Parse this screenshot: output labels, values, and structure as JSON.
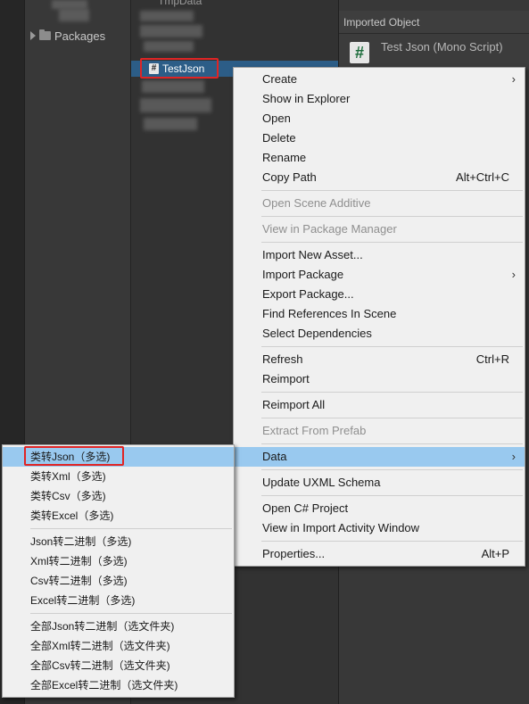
{
  "project": {
    "folder_label": "Packages",
    "top_asset_label": "TmpData"
  },
  "selected_asset": {
    "label": "TestJson"
  },
  "inspector": {
    "header": "Imported Object",
    "object_title": "Test Json (Mono Script)",
    "icon": "#"
  },
  "context_menu": {
    "items": [
      {
        "label": "Create",
        "shortcut": "",
        "submenu": true,
        "disabled": false
      },
      {
        "label": "Show in Explorer",
        "shortcut": "",
        "submenu": false,
        "disabled": false
      },
      {
        "label": "Open",
        "shortcut": "",
        "submenu": false,
        "disabled": false
      },
      {
        "label": "Delete",
        "shortcut": "",
        "submenu": false,
        "disabled": false
      },
      {
        "label": "Rename",
        "shortcut": "",
        "submenu": false,
        "disabled": false
      },
      {
        "label": "Copy Path",
        "shortcut": "Alt+Ctrl+C",
        "submenu": false,
        "disabled": false
      },
      {
        "label": "Open Scene Additive",
        "shortcut": "",
        "submenu": false,
        "disabled": true
      },
      {
        "label": "View in Package Manager",
        "shortcut": "",
        "submenu": false,
        "disabled": true
      },
      {
        "label": "Import New Asset...",
        "shortcut": "",
        "submenu": false,
        "disabled": false
      },
      {
        "label": "Import Package",
        "shortcut": "",
        "submenu": true,
        "disabled": false
      },
      {
        "label": "Export Package...",
        "shortcut": "",
        "submenu": false,
        "disabled": false
      },
      {
        "label": "Find References In Scene",
        "shortcut": "",
        "submenu": false,
        "disabled": false
      },
      {
        "label": "Select Dependencies",
        "shortcut": "",
        "submenu": false,
        "disabled": false
      },
      {
        "label": "Refresh",
        "shortcut": "Ctrl+R",
        "submenu": false,
        "disabled": false
      },
      {
        "label": "Reimport",
        "shortcut": "",
        "submenu": false,
        "disabled": false
      },
      {
        "label": "Reimport All",
        "shortcut": "",
        "submenu": false,
        "disabled": false
      },
      {
        "label": "Extract From Prefab",
        "shortcut": "",
        "submenu": false,
        "disabled": true
      },
      {
        "label": "Data",
        "shortcut": "",
        "submenu": true,
        "disabled": false,
        "highlighted": true
      },
      {
        "label": "Update UXML Schema",
        "shortcut": "",
        "submenu": false,
        "disabled": false
      },
      {
        "label": "Open C# Project",
        "shortcut": "",
        "submenu": false,
        "disabled": false
      },
      {
        "label": "View in Import Activity Window",
        "shortcut": "",
        "submenu": false,
        "disabled": false
      },
      {
        "label": "Properties...",
        "shortcut": "Alt+P",
        "submenu": false,
        "disabled": false
      }
    ]
  },
  "data_submenu": {
    "items": [
      {
        "label": "类转Json（多选)",
        "highlighted": true
      },
      {
        "label": "类转Xml（多选)"
      },
      {
        "label": "类转Csv（多选)"
      },
      {
        "label": "类转Excel（多选)"
      },
      {
        "label": "Json转二进制（多选)"
      },
      {
        "label": "Xml转二进制（多选)"
      },
      {
        "label": "Csv转二进制（多选)"
      },
      {
        "label": "Excel转二进制（多选)"
      },
      {
        "label": "全部Json转二进制（选文件夹)"
      },
      {
        "label": "全部Xml转二进制（选文件夹)"
      },
      {
        "label": "全部Csv转二进制（选文件夹)"
      },
      {
        "label": "全部Excel转二进制（选文件夹)"
      }
    ]
  },
  "colors": {
    "highlight": "#99c9ef",
    "selection": "#2c5d87",
    "annotation": "#e02424",
    "menu_bg": "#f0f0f0"
  }
}
